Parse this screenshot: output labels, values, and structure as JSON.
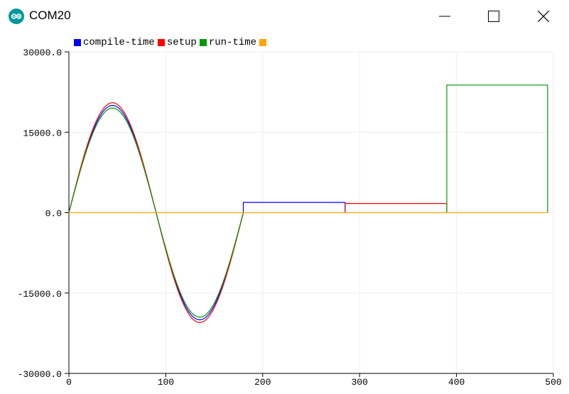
{
  "window": {
    "title": "COM20",
    "icon": "arduino-icon",
    "buttons": [
      "minimize-icon",
      "maximize-icon",
      "close-icon"
    ]
  },
  "legend": [
    {
      "label": "compile-time",
      "color": "#0000ff"
    },
    {
      "label": "setup",
      "color": "#ff0000"
    },
    {
      "label": "run-time",
      "color": "#009900"
    },
    {
      "label": "",
      "color": "#ffa500"
    }
  ],
  "chart_data": {
    "type": "line",
    "xlim": [
      0,
      500
    ],
    "ylim": [
      -30000,
      30000
    ],
    "xticks": [
      "0",
      "100",
      "200",
      "300",
      "400",
      "500"
    ],
    "yticks": [
      "30000.0",
      "15000.0",
      "0.0",
      "-15000.0",
      "-30000.0"
    ],
    "ytick_values": [
      30000,
      15000,
      0,
      -15000,
      -30000
    ],
    "xtick_values": [
      0,
      100,
      200,
      300,
      400,
      500
    ],
    "grid": true,
    "series": [
      {
        "name": "compile-time",
        "color": "#0000ff",
        "segments": [
          {
            "kind": "sine",
            "x_start": 0,
            "x_end": 180,
            "amplitude": 20000
          },
          {
            "kind": "flat",
            "x_start": 180,
            "x_end": 285,
            "y": 1900
          }
        ]
      },
      {
        "name": "setup",
        "color": "#ff0000",
        "segments": [
          {
            "kind": "sine",
            "x_start": 0,
            "x_end": 180,
            "amplitude": 20500,
            "shape": "upper"
          },
          {
            "kind": "flat",
            "x_start": 285,
            "x_end": 390,
            "y": 1700
          }
        ]
      },
      {
        "name": "run-time",
        "color": "#009900",
        "segments": [
          {
            "kind": "sine",
            "x_start": 0,
            "x_end": 180,
            "amplitude": 19500,
            "shape": "lower"
          },
          {
            "kind": "flat",
            "x_start": 390,
            "x_end": 494,
            "y": 23800
          }
        ]
      },
      {
        "name": "",
        "color": "#ffa500",
        "segments": [
          {
            "kind": "flat",
            "x_start": 0,
            "x_end": 494,
            "y": 0
          }
        ]
      }
    ]
  }
}
